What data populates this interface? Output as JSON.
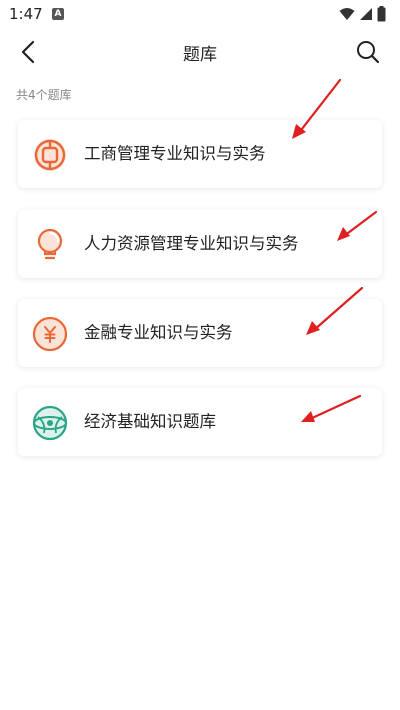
{
  "status_bar": {
    "time": "1:47"
  },
  "header": {
    "title": "题库"
  },
  "count_label": "共4个题库",
  "cards": [
    {
      "label": "工商管理专业知识与实务"
    },
    {
      "label": "人力资源管理专业知识与实务"
    },
    {
      "label": "金融专业知识与实务"
    },
    {
      "label": "经济基础知识题库"
    }
  ],
  "colors": {
    "accent": "#E8683A",
    "teal": "#2BA58A",
    "arrow": "#E02020"
  }
}
